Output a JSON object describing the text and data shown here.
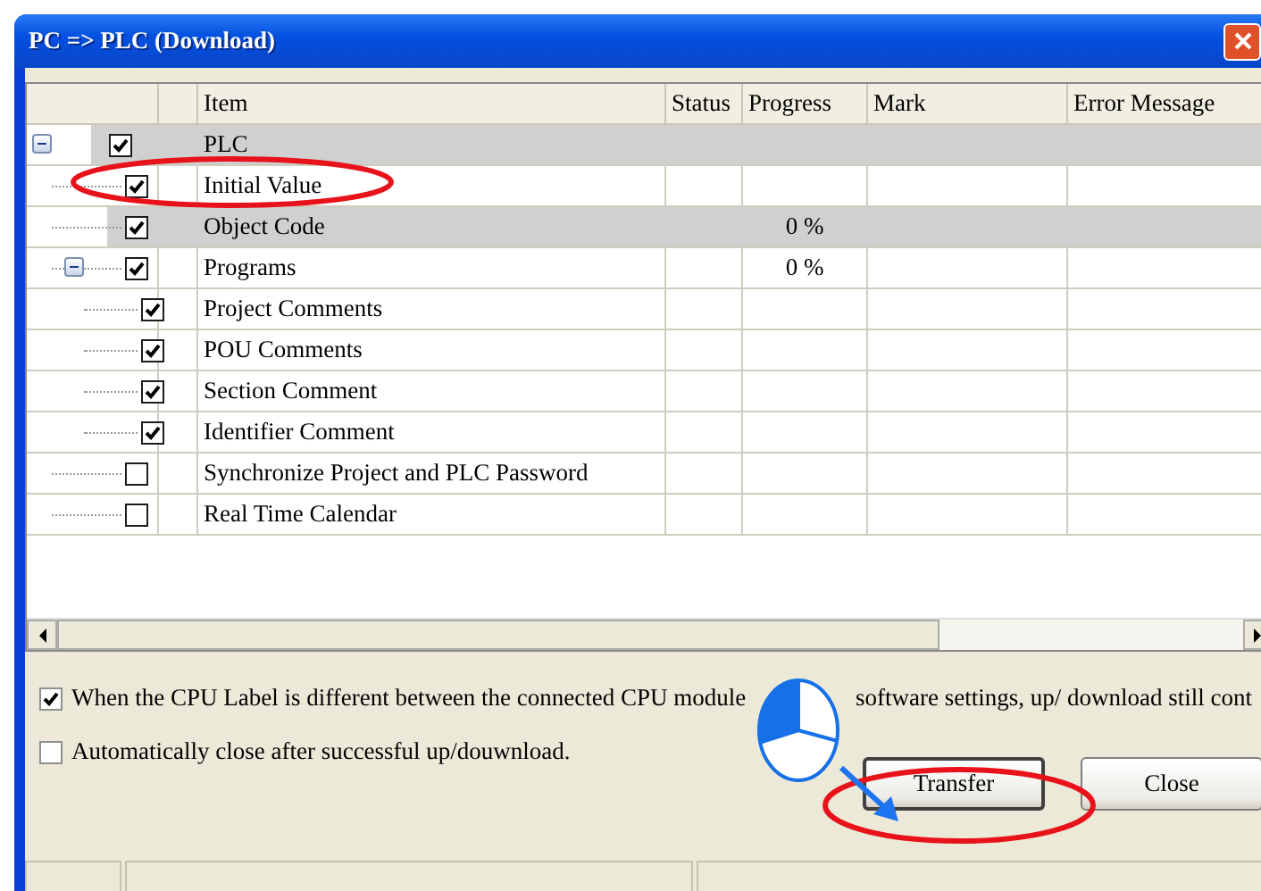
{
  "window": {
    "title": "PC => PLC (Download)"
  },
  "table": {
    "columns": [
      "Item",
      "Status",
      "Progress",
      "Mark",
      "Error Message"
    ],
    "rows": [
      {
        "item": "PLC",
        "checked": true,
        "highlighted": true,
        "expanded": true,
        "children": [
          {
            "item": "Initial Value",
            "checked": true,
            "highlighted": false
          },
          {
            "item": "Object Code",
            "checked": true,
            "highlighted": true,
            "progress": "0 %"
          },
          {
            "item": "Programs",
            "checked": true,
            "highlighted": false,
            "expanded": true,
            "progress": "0 %",
            "children": [
              {
                "item": "Project Comments",
                "checked": true,
                "highlighted": false
              },
              {
                "item": "POU Comments",
                "checked": true,
                "highlighted": false
              },
              {
                "item": "Section Comment",
                "checked": true,
                "highlighted": false
              },
              {
                "item": "Identifier Comment",
                "checked": true,
                "highlighted": false
              }
            ]
          },
          {
            "item": "Synchronize Project and PLC Password",
            "checked": false,
            "highlighted": false
          },
          {
            "item": "Real Time Calendar",
            "checked": false,
            "highlighted": false
          }
        ]
      }
    ]
  },
  "options": [
    {
      "checked": true,
      "label_parts": [
        "When the CPU Label is different between the connected CPU module",
        "software settings, up/ download still cont"
      ]
    },
    {
      "checked": false,
      "label_parts": [
        "Automatically close after successful up/douwnload."
      ]
    }
  ],
  "buttons": [
    {
      "label": "Transfer",
      "default": true
    },
    {
      "label": "Close",
      "default": false
    }
  ]
}
